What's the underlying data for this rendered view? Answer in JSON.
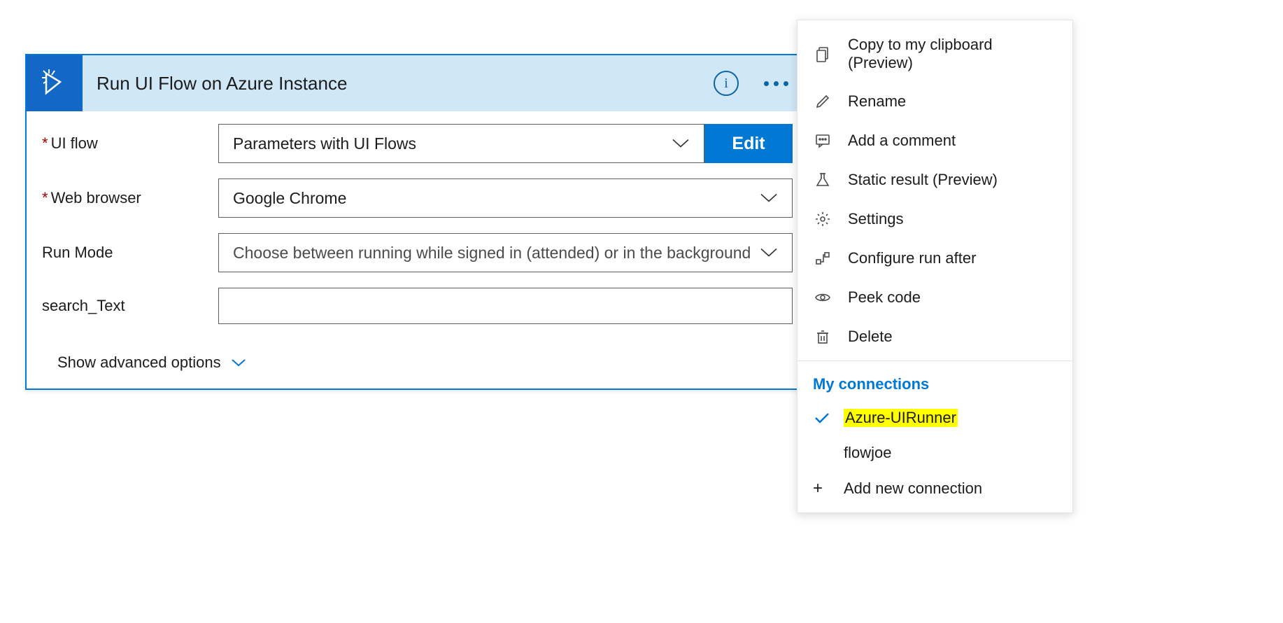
{
  "card": {
    "title": "Run UI Flow on Azure Instance",
    "fields": {
      "uiflow": {
        "label": "UI flow",
        "value": "Parameters with UI Flows",
        "edit_button": "Edit"
      },
      "browser": {
        "label": "Web browser",
        "value": "Google Chrome"
      },
      "runmode": {
        "label": "Run Mode",
        "placeholder": "Choose between running while signed in (attended) or in the background"
      },
      "search": {
        "label": "search_Text",
        "value": ""
      }
    },
    "advanced": "Show advanced options"
  },
  "menu": {
    "items": [
      {
        "label": "Copy to my clipboard (Preview)"
      },
      {
        "label": "Rename"
      },
      {
        "label": "Add a comment"
      },
      {
        "label": "Static result (Preview)"
      },
      {
        "label": "Settings"
      },
      {
        "label": "Configure run after"
      },
      {
        "label": "Peek code"
      },
      {
        "label": "Delete"
      }
    ],
    "connections_title": "My connections",
    "connections": [
      {
        "label": "Azure-UIRunner",
        "selected": true,
        "highlighted": true
      },
      {
        "label": "flowjoe",
        "selected": false
      }
    ],
    "add_connection": "Add new connection"
  }
}
